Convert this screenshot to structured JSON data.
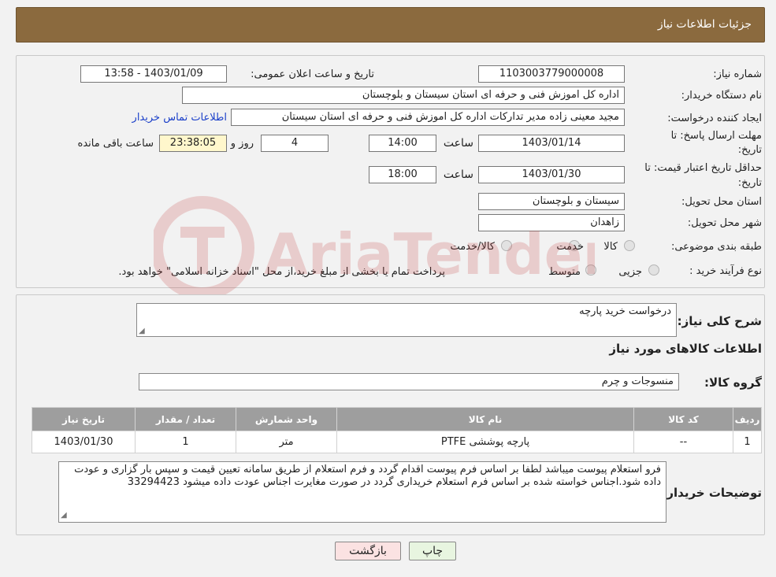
{
  "header": {
    "title": "جزئیات اطلاعات نیاز"
  },
  "labels": {
    "need_number": "شماره نیاز:",
    "announce_datetime": "تاریخ و ساعت اعلان عمومی:",
    "buyer_org": "نام دستگاه خریدار:",
    "requester": "ایجاد کننده درخواست:",
    "reply_deadline_line1": "مهلت ارسال پاسخ: تا",
    "reply_deadline_line2": "تاریخ:",
    "time_word": "ساعت",
    "day_and": "روز و",
    "remaining": "ساعت باقی مانده",
    "price_validity_line1": "حداقل تاریخ اعتبار قیمت: تا",
    "price_validity_line2": "تاریخ:",
    "delivery_province": "استان محل تحویل:",
    "delivery_city": "شهر محل تحویل:",
    "category": "طبقه بندی موضوعی:",
    "process_type": "نوع فرآیند خرید :",
    "general_desc": "شرح کلی نیاز:",
    "goods_info": "اطلاعات کالاهای مورد نیاز",
    "goods_group": "گروه کالا:",
    "buyer_notes": "توضیحات خریدار:"
  },
  "values": {
    "need_number": "1103003779000008",
    "announce_datetime": "1403/01/09 - 13:58",
    "buyer_org": "اداره کل اموزش فنی و حرفه ای استان سیستان و بلوچستان",
    "requester": "مجید معینی زاده مدیر تدارکات اداره کل اموزش فنی و حرفه ای استان سیستان",
    "contact_link": "اطلاعات تماس خریدار",
    "reply_date": "1403/01/14",
    "reply_time": "14:00",
    "reply_days": "4",
    "reply_remaining": "23:38:05",
    "price_date": "1403/01/30",
    "price_time": "18:00",
    "delivery_province": "سیستان و بلوچستان",
    "delivery_city": "زاهدان",
    "general_desc": "درخواست خرید پارچه",
    "goods_group": "منسوجات و چرم",
    "buyer_notes": "فرو استعلام پیوست میباشد لطفا بر اساس فرم پیوست اقدام گردد و فرم استعلام از طریق سامانه تعیین قیمت و سپس بار گزاری و عودت داده شود.اجناس خواسته شده بر اساس فرم استعلام خریداری گردد در صورت مغایرت اجناس عودت داده میشود 33294423"
  },
  "category_options": [
    "کالا",
    "خدمت",
    "کالا/خدمت"
  ],
  "process_options": [
    "جزیی",
    "متوسط"
  ],
  "process_note": "پرداخت تمام یا بخشی از مبلغ خرید،از محل \"اسناد خزانه اسلامی\" خواهد بود.",
  "table": {
    "headers": [
      "ردیف",
      "کد کالا",
      "نام کالا",
      "واحد شمارش",
      "تعداد / مقدار",
      "تاریخ نیاز"
    ],
    "rows": [
      [
        "1",
        "--",
        "پارچه پوششی PTFE",
        "متر",
        "1",
        "1403/01/30"
      ]
    ]
  },
  "buttons": {
    "print": "چاپ",
    "back": "بازگشت"
  },
  "watermark": {
    "text": "AriaTender.neT"
  },
  "colors": {
    "header_bg": "#8b6a3e",
    "table_header_bg": "#9e9e9e",
    "print_button_bg": "#e8f5e0",
    "back_button_bg": "#fbe2e2",
    "link": "#1a3fc9"
  }
}
